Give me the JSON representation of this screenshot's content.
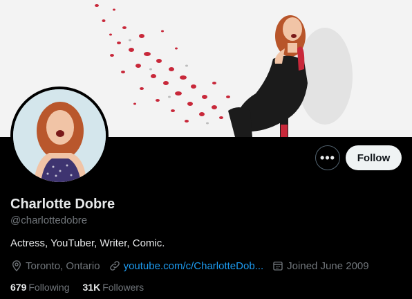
{
  "profile": {
    "display_name": "Charlotte Dobre",
    "handle": "@charlottedobre",
    "bio": "Actress, YouTuber, Writer, Comic.",
    "location": "Toronto, Ontario",
    "website": "youtube.com/c/CharlotteDob...",
    "joined": "Joined June 2009"
  },
  "actions": {
    "more_label": "•••",
    "follow_label": "Follow"
  },
  "stats": {
    "following_count": "679",
    "following_label": "Following",
    "followers_count": "31K",
    "followers_label": "Followers"
  },
  "icons": {
    "location": "location-pin-icon",
    "link": "link-icon",
    "calendar": "calendar-icon"
  },
  "colors": {
    "background": "#000000",
    "accent_link": "#1d9bf0",
    "secondary_text": "#71767b",
    "primary_text": "#e7e9ea",
    "follow_button_bg": "#eff3f4"
  }
}
